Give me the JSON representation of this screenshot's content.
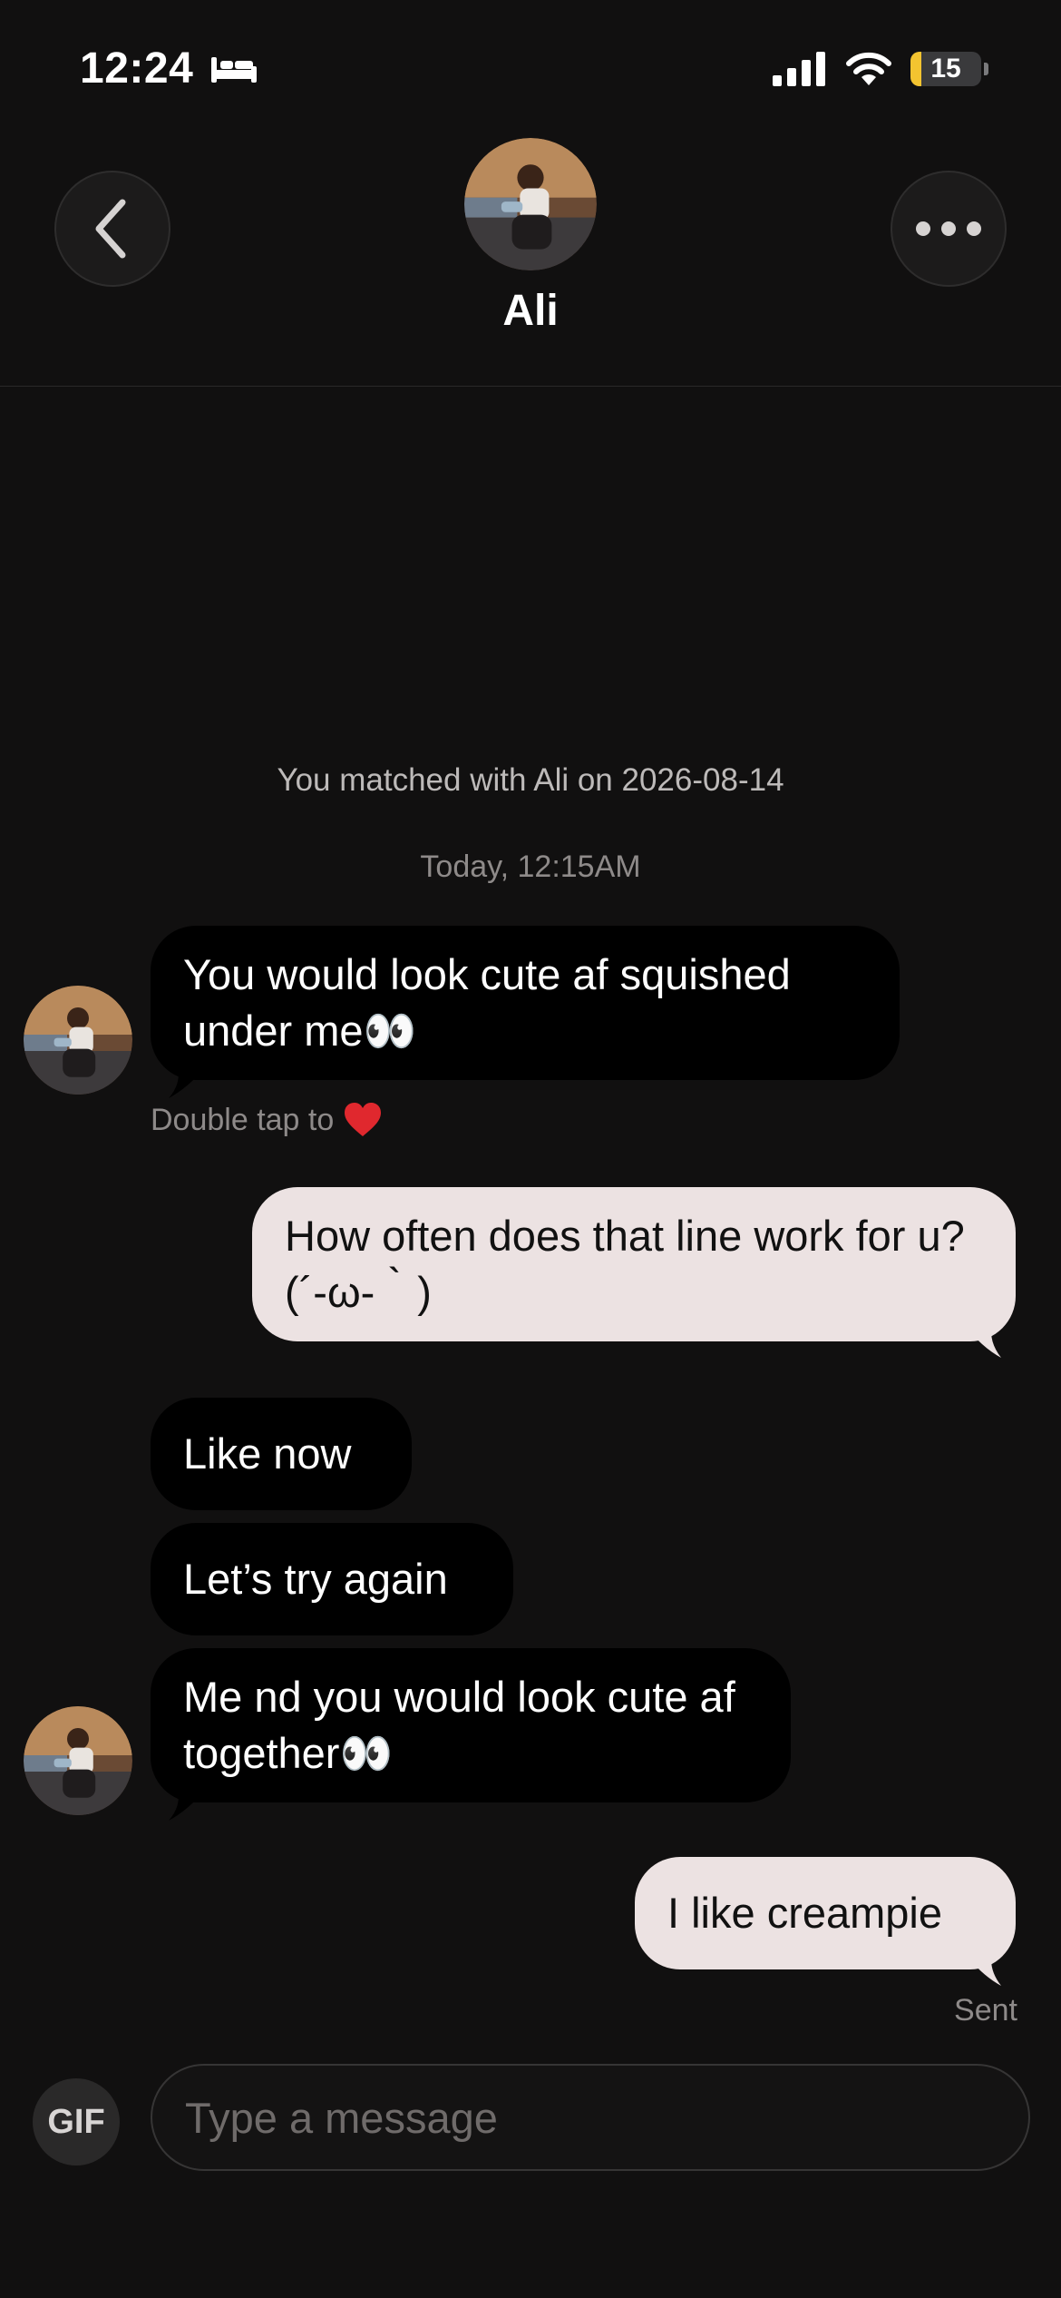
{
  "status_bar": {
    "time": "12:24",
    "focus_icon": "bed-icon",
    "battery_level": "15",
    "battery_color": "#f4c430"
  },
  "header": {
    "contact_name": "Ali",
    "back_icon": "chevron-left-icon",
    "more_icon": "ellipsis-icon"
  },
  "conversation": {
    "match_note": "You matched with Ali on 2026-08-14",
    "date_note": "Today, 12:15AM",
    "messages": [
      {
        "from": "them",
        "text": "You would look cute af squished under me👀"
      },
      {
        "from": "me",
        "text": "How often does that line work for u? (´-ω-｀)"
      },
      {
        "from": "them",
        "text": "Like now"
      },
      {
        "from": "them",
        "text": "Let’s try again"
      },
      {
        "from": "them",
        "text": "Me nd you would look cute af together👀"
      },
      {
        "from": "me",
        "text": "I like creampie"
      }
    ],
    "double_tap_hint": "Double tap to",
    "sent_label": "Sent"
  },
  "composer": {
    "gif_label": "GIF",
    "placeholder": "Type a message"
  },
  "colors": {
    "background": "#111010",
    "incoming_bubble": "#000000",
    "outgoing_bubble": "#ece2e2",
    "heart": "#e0282e"
  }
}
